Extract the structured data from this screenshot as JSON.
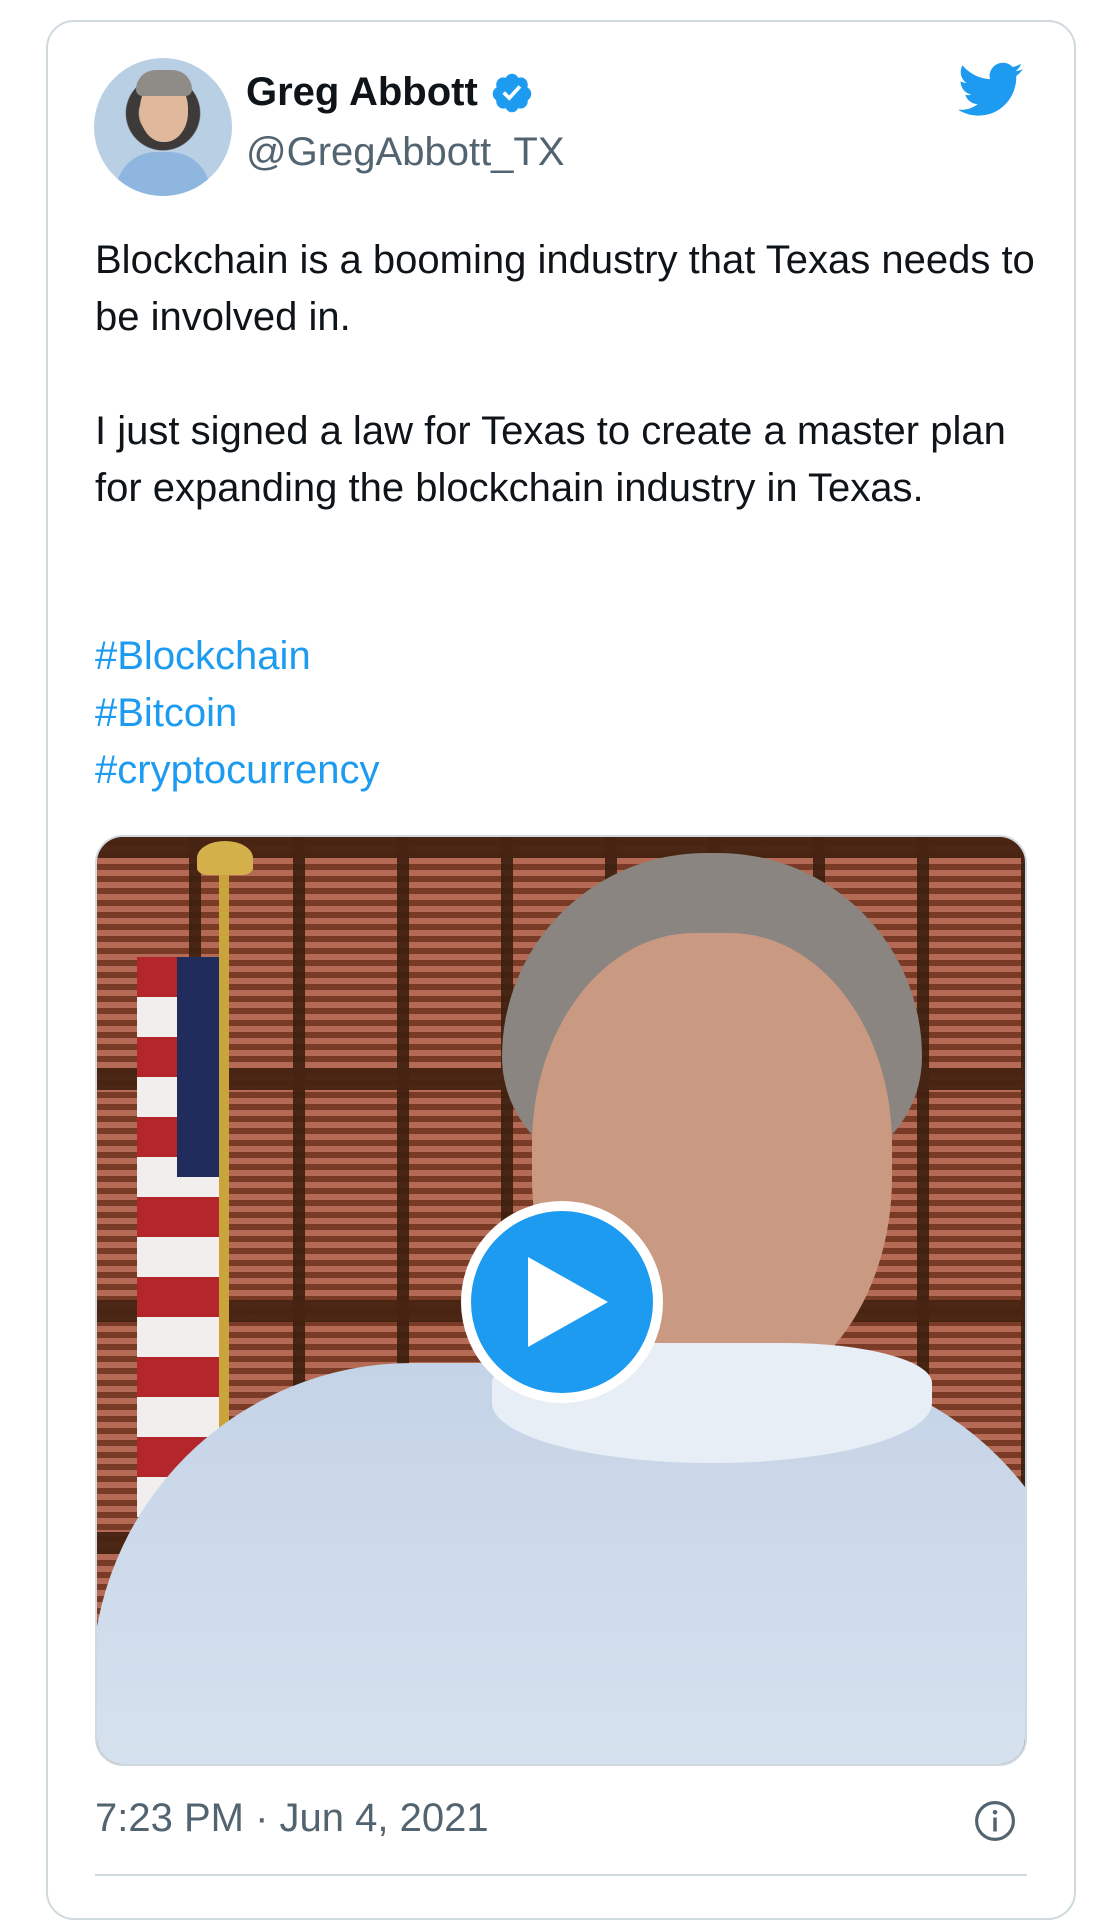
{
  "author": {
    "name": "Greg Abbott",
    "handle": "@GregAbbott_TX",
    "verified": true
  },
  "tweet": {
    "paragraphs": [
      "Blockchain is a booming industry that Texas needs to be involved in.",
      "I just signed a law for Texas to create a master plan for expanding the blockchain industry in Texas."
    ],
    "hashtags": [
      "#Blockchain",
      "#Bitcoin",
      "#cryptocurrency"
    ]
  },
  "media": {
    "type": "video",
    "icon": "play-icon"
  },
  "footer": {
    "timestamp": "7:23 PM · Jun 4, 2021",
    "info_icon": "info-icon"
  },
  "colors": {
    "accent": "#1d9bf0",
    "text": "#0f1419",
    "secondary": "#536471",
    "border": "#cfd9de"
  }
}
